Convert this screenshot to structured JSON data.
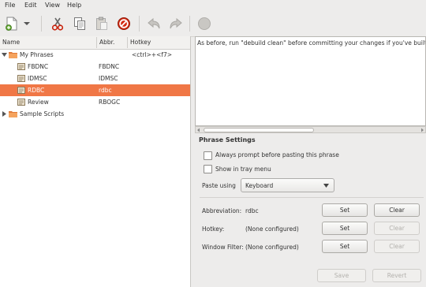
{
  "menu": [
    "File",
    "Edit",
    "View",
    "Help"
  ],
  "toolbar": {
    "icons": [
      "new-icon",
      "dropdown-arrow-icon",
      "cut-icon",
      "copy-icon",
      "paste-icon",
      "delete-icon",
      "undo-icon",
      "redo-icon",
      "record-icon"
    ]
  },
  "tree": {
    "columns": [
      "Name",
      "Abbr.",
      "Hotkey"
    ],
    "rows": [
      {
        "name": "My Phrases",
        "abbr": "",
        "hotkey": "<ctrl>+<f7>",
        "type": "folder",
        "expanded": true
      },
      {
        "name": "FBDNC",
        "abbr": "FBDNC",
        "hotkey": "",
        "type": "phrase"
      },
      {
        "name": "IDMSC",
        "abbr": "IDMSC",
        "hotkey": "",
        "type": "phrase"
      },
      {
        "name": "RDBC",
        "abbr": "rdbc",
        "hotkey": "",
        "type": "phrase",
        "selected": true
      },
      {
        "name": "Review",
        "abbr": "RBOGC",
        "hotkey": "",
        "type": "phrase"
      },
      {
        "name": "Sample Scripts",
        "abbr": "",
        "hotkey": "",
        "type": "folder",
        "expanded": false
      }
    ]
  },
  "editor": {
    "text": "As before, run \"debuild clean\" before committing your changes if you've built"
  },
  "settings": {
    "title": "Phrase Settings",
    "always_prompt": "Always prompt before pasting this phrase",
    "show_tray": "Show in tray menu",
    "paste_using_label": "Paste using",
    "paste_using_value": "Keyboard",
    "abbreviation_label": "Abbreviation:",
    "abbreviation_value": "rdbc",
    "hotkey_label": "Hotkey:",
    "hotkey_value": "(None configured)",
    "filter_label": "Window Filter:",
    "filter_value": "(None configured)",
    "set": "Set",
    "clear": "Clear",
    "save": "Save",
    "revert": "Revert"
  },
  "colors": {
    "selection": "#f07746",
    "accent_red": "#c9210b"
  }
}
